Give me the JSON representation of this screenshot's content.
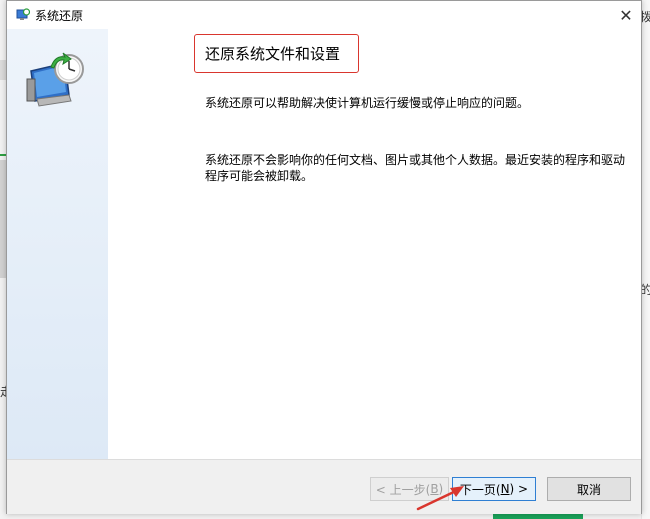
{
  "window": {
    "title": "系统还原",
    "close_glyph": "✕"
  },
  "content": {
    "heading": "还原系统文件和设置",
    "paragraph1": "系统还原可以帮助解决使计算机运行缓慢或停止响应的问题。",
    "paragraph2": "系统还原不会影响你的任何文档、图片或其他个人数据。最近安装的程序和驱动程序可能会被卸载。"
  },
  "footer": {
    "back_label": "< 上一步(",
    "back_key": "B",
    "back_tail": ")",
    "next_label": "下一页(",
    "next_key": "N",
    "next_tail": ") >",
    "cancel_label": "取消"
  },
  "background": {
    "right_char_top": "拨",
    "right_char_mid": "的",
    "left_char": "走"
  },
  "colors": {
    "highlight_box": "#d9362e",
    "default_button_border": "#2f7fd3",
    "annotation_arrow": "#d9362e"
  },
  "icons": [
    "system-restore-icon",
    "close-icon",
    "annotation-arrow"
  ]
}
